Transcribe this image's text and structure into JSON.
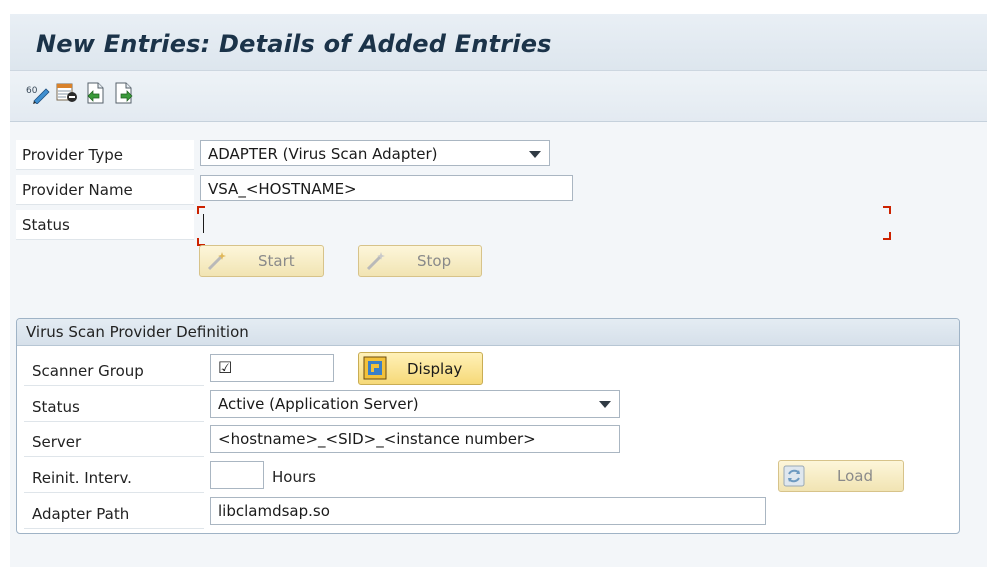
{
  "title": "New Entries: Details of Added Entries",
  "toolbar": {
    "icons": [
      "change-display-icon",
      "delete-row-icon",
      "previous-entry-icon",
      "next-entry-icon"
    ]
  },
  "form": {
    "provider_type_label": "Provider Type",
    "provider_type_value": "ADAPTER (Virus Scan Adapter)",
    "provider_name_label": "Provider Name",
    "provider_name_value": "VSA_<HOSTNAME>",
    "status_label": "Status",
    "status_value": "",
    "start_label": "Start",
    "stop_label": "Stop"
  },
  "group": {
    "title": "Virus Scan Provider Definition",
    "scanner_group_label": "Scanner Group",
    "scanner_group_value": "☑",
    "display_label": "Display",
    "status_label": "Status",
    "status_value": "Active (Application Server)",
    "server_label": "Server",
    "server_value": "<hostname>_<SID>_<instance number>",
    "reinit_label": "Reinit. Interv.",
    "reinit_value": "",
    "hours_label": "Hours",
    "load_label": "Load",
    "adapter_path_label": "Adapter Path",
    "adapter_path_value": "libclamdsap.so"
  },
  "colors": {
    "title": "#1b3349",
    "button_fill": "#f6d978",
    "status_marker": "#cc2200"
  }
}
